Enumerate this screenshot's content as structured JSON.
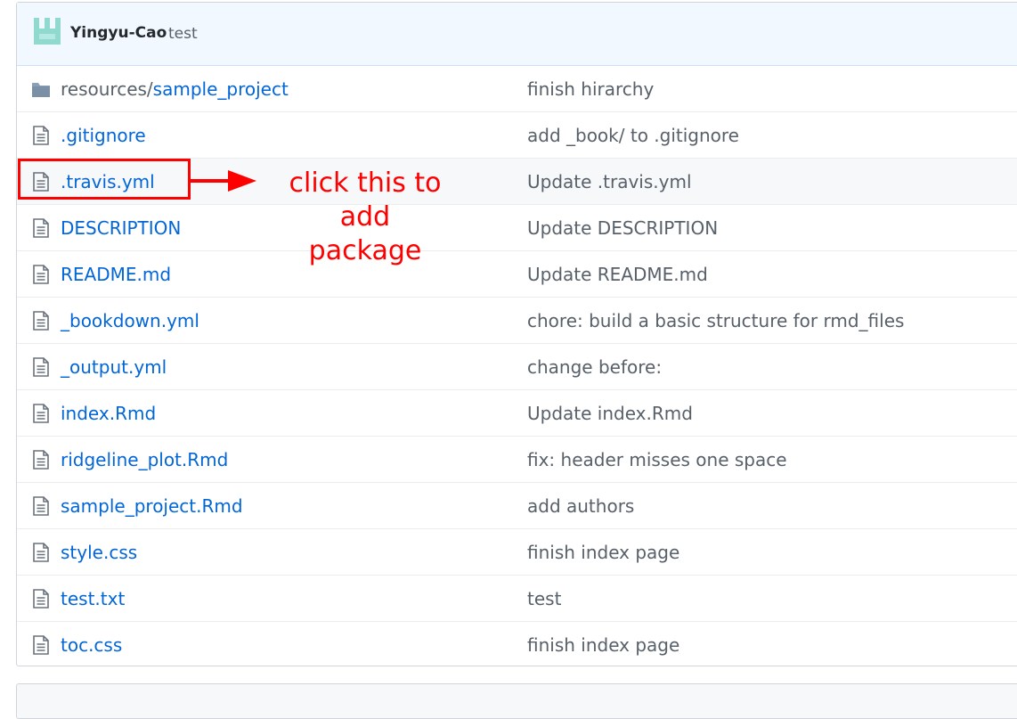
{
  "commit": {
    "author": "Yingyu-Cao",
    "message": "test"
  },
  "files": [
    {
      "type": "dir",
      "prefix": "resources/",
      "name": "sample_project",
      "message": "finish hirarchy",
      "icon": "folder-icon"
    },
    {
      "type": "file",
      "prefix": "",
      "name": ".gitignore",
      "message": "add _book/ to .gitignore",
      "icon": "file-icon"
    },
    {
      "type": "file",
      "prefix": "",
      "name": ".travis.yml",
      "message": "Update .travis.yml",
      "icon": "file-icon"
    },
    {
      "type": "file",
      "prefix": "",
      "name": "DESCRIPTION",
      "message": "Update DESCRIPTION",
      "icon": "file-icon"
    },
    {
      "type": "file",
      "prefix": "",
      "name": "README.md",
      "message": "Update README.md",
      "icon": "file-icon"
    },
    {
      "type": "file",
      "prefix": "",
      "name": "_bookdown.yml",
      "message": "chore: build a basic structure for rmd_files",
      "icon": "file-icon"
    },
    {
      "type": "file",
      "prefix": "",
      "name": "_output.yml",
      "message": "change before:",
      "icon": "file-icon"
    },
    {
      "type": "file",
      "prefix": "",
      "name": "index.Rmd",
      "message": "Update index.Rmd",
      "icon": "file-icon"
    },
    {
      "type": "file",
      "prefix": "",
      "name": "ridgeline_plot.Rmd",
      "message": "fix: header misses one space",
      "icon": "file-icon"
    },
    {
      "type": "file",
      "prefix": "",
      "name": "sample_project.Rmd",
      "message": "add authors",
      "icon": "file-icon"
    },
    {
      "type": "file",
      "prefix": "",
      "name": "style.css",
      "message": "finish index page",
      "icon": "file-icon"
    },
    {
      "type": "file",
      "prefix": "",
      "name": "test.txt",
      "message": "test",
      "icon": "file-icon"
    },
    {
      "type": "file",
      "prefix": "",
      "name": "toc.css",
      "message": "finish index page",
      "icon": "file-icon"
    }
  ],
  "annotation": {
    "line1": "click this to add",
    "line2": "package",
    "color": "#ff0000"
  },
  "colors": {
    "link": "#0366d6",
    "header_bg": "#f1f8ff",
    "folder": "#79b8ff"
  }
}
